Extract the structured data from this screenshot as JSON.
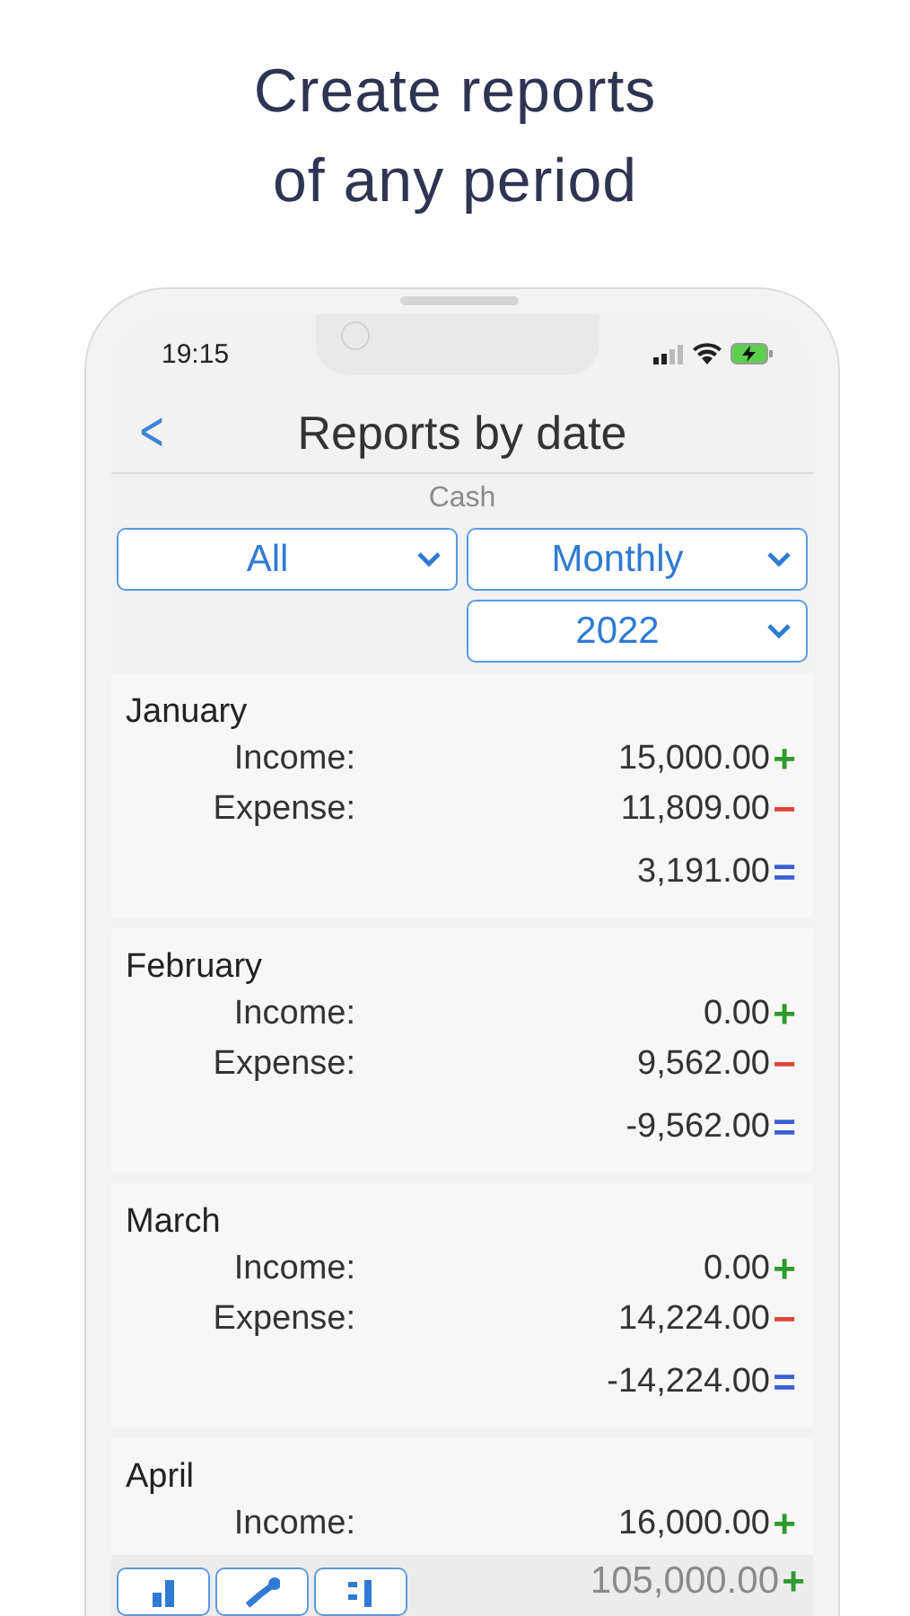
{
  "headline": [
    "Create reports",
    "of any period"
  ],
  "status_bar": {
    "time": "19:15"
  },
  "nav": {
    "back": "<",
    "title": "Reports by date"
  },
  "account": "Cash",
  "filters": [
    {
      "value": "All"
    },
    {
      "value": "Monthly"
    },
    {
      "value": "2022"
    }
  ],
  "reports": [
    {
      "period": "January",
      "rows": [
        {
          "kind": "income",
          "label": "Income:",
          "amount": "15,000.00",
          "sign": "+"
        },
        {
          "kind": "expense",
          "label": "Expense:",
          "amount": "11,809.00",
          "sign": "−"
        },
        {
          "kind": "total",
          "amount": "3,191.00",
          "sign": "="
        }
      ]
    },
    {
      "period": "February",
      "rows": [
        {
          "kind": "income",
          "label": "Income:",
          "amount": "0.00",
          "sign": "+"
        },
        {
          "kind": "expense",
          "label": "Expense:",
          "amount": "9,562.00",
          "sign": "−"
        },
        {
          "kind": "total",
          "amount": "-9,562.00",
          "sign": "="
        }
      ]
    },
    {
      "period": "March",
      "rows": [
        {
          "kind": "income",
          "label": "Income:",
          "amount": "0.00",
          "sign": "+"
        },
        {
          "kind": "expense",
          "label": "Expense:",
          "amount": "14,224.00",
          "sign": "−"
        },
        {
          "kind": "total",
          "amount": "-14,224.00",
          "sign": "="
        }
      ]
    },
    {
      "period": "April",
      "rows": [
        {
          "kind": "income",
          "label": "Income:",
          "amount": "16,000.00",
          "sign": "+"
        }
      ]
    }
  ],
  "toolbar": {
    "buttons": [
      {
        "kind": "bar-chart"
      },
      {
        "kind": "line-chart"
      },
      {
        "kind": "dot-bars"
      }
    ],
    "total": {
      "kind": "income",
      "amount": "105,000.00",
      "sign": "+"
    }
  }
}
